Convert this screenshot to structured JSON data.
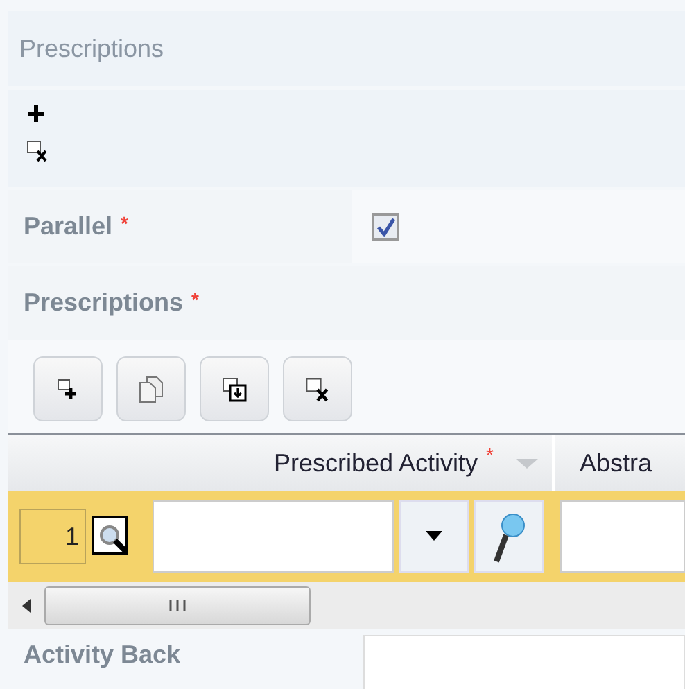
{
  "panel": {
    "title": "Prescriptions"
  },
  "actions": [
    {
      "kind": "add"
    },
    {
      "kind": "remove"
    }
  ],
  "fields": [
    {
      "kind": "checkbox",
      "label": "Parallel",
      "mark": "*",
      "checked": true
    },
    {
      "kind": "heading",
      "label": "Prescriptions",
      "mark": "*"
    }
  ],
  "toolbar": [
    {
      "kind": "add"
    },
    {
      "kind": "copy"
    },
    {
      "kind": "insert"
    },
    {
      "kind": "remove"
    }
  ],
  "table": {
    "columns": [
      {
        "label": "Prescribed Activity",
        "mark": "*"
      },
      {
        "label": "Abstra"
      }
    ],
    "rows": [
      {
        "number": "1",
        "selected": true
      }
    ]
  },
  "next_field": {
    "label": "Activity Back"
  }
}
